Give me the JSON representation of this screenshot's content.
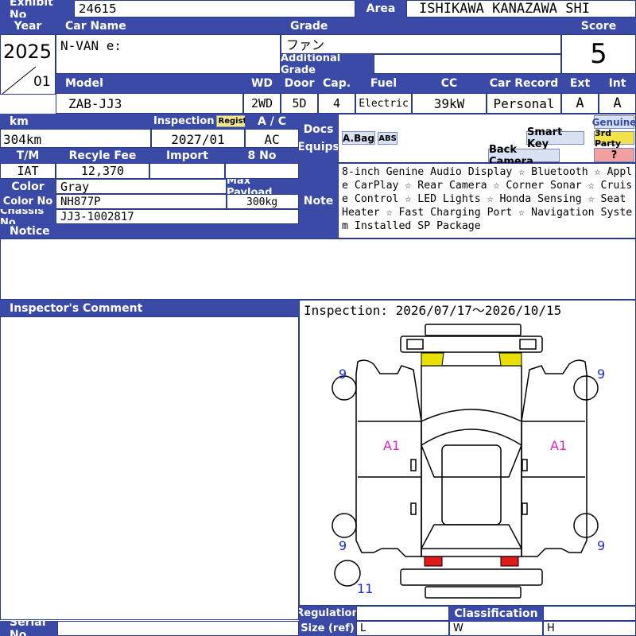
{
  "exhibit": {
    "label": "Exhibit No",
    "value": "24615"
  },
  "area": {
    "label": "Area",
    "value": "ISHIKAWA KANAZAWA SHI"
  },
  "year": {
    "label": "Year",
    "value": "2025",
    "month": "01"
  },
  "car_name": {
    "label": "Car Name",
    "value": "N-VAN e:"
  },
  "grade": {
    "label": "Grade",
    "value": "ファン"
  },
  "additional_grade": {
    "label": "Additional Grade",
    "value": ""
  },
  "score": {
    "label": "Score",
    "value": "5"
  },
  "spec_headers": {
    "model": "Model",
    "wd": "WD",
    "door": "Door",
    "cap": "Cap.",
    "fuel": "Fuel",
    "cc": "CC",
    "car_record": "Car Record",
    "ext": "Ext",
    "int": "Int"
  },
  "spec_values": {
    "model": "ZAB-JJ3",
    "wd": "2WD",
    "door": "5D",
    "cap": "4",
    "fuel": "Electric",
    "cc": "39kW",
    "car_record": "Personal",
    "ext": "A",
    "int": "A"
  },
  "km": {
    "label": "km",
    "value": "304km"
  },
  "inspection": {
    "label": "Inspection",
    "badge": "Regist",
    "value": "2027/01"
  },
  "ac": {
    "label": "A / C",
    "value": "AC"
  },
  "docs": {
    "label": "Docs Equips"
  },
  "equips": {
    "abag": "A.Bag",
    "abs": "ABS",
    "smart_key": "Smart Key",
    "back_camera": "Back Camera",
    "genuine": "Genuine",
    "third_party": "3rd Party",
    "unknown": "?"
  },
  "tm": {
    "label": "T/M",
    "value": "IAT"
  },
  "recycle": {
    "label": "Recyle Fee",
    "value": "12,370"
  },
  "import": {
    "label": "Import",
    "value": ""
  },
  "eight_no": {
    "label": "8 No",
    "value": ""
  },
  "color": {
    "label": "Color",
    "value": "Gray"
  },
  "max_payload": {
    "label": "Max Payload",
    "value": "300kg"
  },
  "color_no": {
    "label": "Color No",
    "value": "NH877P"
  },
  "chassis": {
    "label": "Chassis No",
    "value": "JJ3-1002817"
  },
  "notice": {
    "label": "Notice"
  },
  "note": {
    "label": "Note",
    "value": "8-inch Genine Audio Display ☆ Bluetooth ☆ Apple CarPlay ☆ Rear Camera ☆ Corner Sonar ☆ Cruise Control ☆ LED Lights ☆ Honda Sensing ☆ Seat Heater ☆ Fast Charging Port ☆ Navigation System Installed SP Package"
  },
  "inspector_comment": {
    "label": "Inspector's Comment"
  },
  "inspection_period": {
    "value": "Inspection: 2026/07/17〜2026/10/15"
  },
  "diagram": {
    "marks": {
      "left_side": "A1",
      "right_side": "A1",
      "fl": "9",
      "fr": "9",
      "rl": "9",
      "rr": "9",
      "spare": "11"
    }
  },
  "regulation": {
    "label": "Regulation"
  },
  "classification": {
    "label": "Classification"
  },
  "size": {
    "label": "Size (ref)",
    "l": "L",
    "w": "W",
    "h": "H"
  },
  "serial": {
    "label": "Serial No"
  },
  "colors": {
    "header": "#3a4aa6",
    "border": "#2c3a8a",
    "headlight": "#e8e000",
    "taillight": "#e0191b",
    "mark": "#e020c0",
    "wheel_num": "#1a2bd0"
  }
}
